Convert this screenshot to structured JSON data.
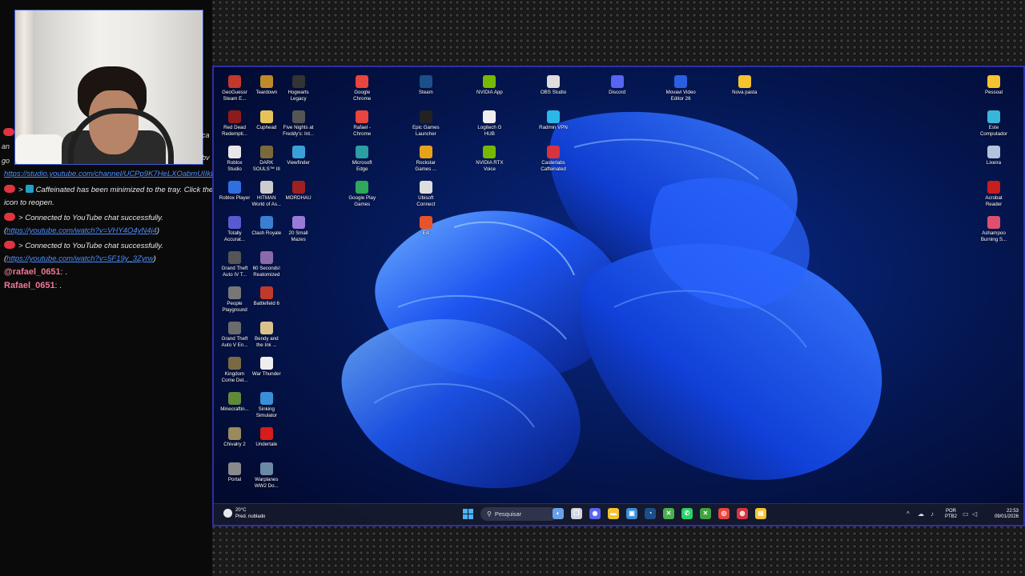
{
  "chat": {
    "side_fragments": {
      "left_a": "an",
      "left_b": "go",
      "right_a": "ca",
      "right_b": "bv"
    },
    "studio_link": "https://studio.youtube.com/channel/UCPp9K7HeLXOabmUIIkEgZ",
    "lines": [
      {
        "id": "minimized",
        "prefix": ">",
        "app": "Caffeinated",
        "text": " has been minimized to the tray. Click the",
        "cont": "icon to reopen."
      },
      {
        "id": "connected1",
        "prefix": ">",
        "text": "Connected to YouTube chat successfully.",
        "link": "https://youtube.com/watch?v=VHY4O4yN4j4"
      },
      {
        "id": "connected2",
        "prefix": ">",
        "text": "Connected to YouTube chat successfully.",
        "link": "https://youtube.com/watch?v=5F19y_3Zyrw"
      }
    ],
    "messages": [
      {
        "user": "@rafael_0651",
        "text": ": ."
      },
      {
        "user": "Rafael_0651",
        "text": ": ."
      }
    ]
  },
  "desktop": {
    "icons": [
      {
        "col": 0,
        "row": 0,
        "label": "GeoGuessr\nSteam E...",
        "icon": "geoguessr-icon",
        "color": "#c0392b"
      },
      {
        "col": 0,
        "row": 1,
        "label": "Red Dead\nRedempti...",
        "icon": "red-dead-icon",
        "color": "#8e1b1b"
      },
      {
        "col": 0,
        "row": 2,
        "label": "Roblox\nStudio",
        "icon": "roblox-studio-icon",
        "color": "#e8e8e8"
      },
      {
        "col": 0,
        "row": 3,
        "label": "Roblox Player",
        "icon": "roblox-player-icon",
        "color": "#2f6fe0"
      },
      {
        "col": 0,
        "row": 4,
        "label": "Totally\nAccurat...",
        "icon": "tabs-icon",
        "color": "#5a5acf"
      },
      {
        "col": 0,
        "row": 5,
        "label": "Grand Theft\nAuto IV T...",
        "icon": "gta4-icon",
        "color": "#555"
      },
      {
        "col": 0,
        "row": 6,
        "label": "People\nPlayground",
        "icon": "people-playground-icon",
        "color": "#777"
      },
      {
        "col": 0,
        "row": 7,
        "label": "Grand Theft\nAuto V En...",
        "icon": "gta5-icon",
        "color": "#6b6b6b"
      },
      {
        "col": 0,
        "row": 8,
        "label": "Kingdom\nCome Del...",
        "icon": "kingdom-come-icon",
        "color": "#7a6a44"
      },
      {
        "col": 0,
        "row": 9,
        "label": "Minecraftin...",
        "icon": "minecraft-icon",
        "color": "#5f8a3a"
      },
      {
        "col": 0,
        "row": 10,
        "label": "Chivalry 2",
        "icon": "chivalry-icon",
        "color": "#9b8a5c"
      },
      {
        "col": 0,
        "row": 11,
        "label": "Portal",
        "icon": "portal-icon",
        "color": "#8a8a8a"
      },
      {
        "col": 1,
        "row": 0,
        "label": "Teardown",
        "icon": "teardown-icon",
        "color": "#c08a2a"
      },
      {
        "col": 1,
        "row": 1,
        "label": "Cuphead",
        "icon": "cuphead-icon",
        "color": "#e6c35a"
      },
      {
        "col": 1,
        "row": 2,
        "label": "DARK\nSOULS™ III",
        "icon": "dark-souls-icon",
        "color": "#7a6a3a"
      },
      {
        "col": 1,
        "row": 3,
        "label": "HITMAN\nWorld of As...",
        "icon": "hitman-icon",
        "color": "#cccccc"
      },
      {
        "col": 1,
        "row": 4,
        "label": "Clash Royale",
        "icon": "clash-royale-icon",
        "color": "#3a7fd0"
      },
      {
        "col": 1,
        "row": 5,
        "label": "60 Seconds!\nReatomized",
        "icon": "sixty-seconds-icon",
        "color": "#8a6aa8"
      },
      {
        "col": 1,
        "row": 6,
        "label": "Battlefield 6",
        "icon": "battlefield-icon",
        "color": "#c0392b"
      },
      {
        "col": 1,
        "row": 7,
        "label": "Bendy and\nthe Ink ...",
        "icon": "bendy-icon",
        "color": "#d9c38a"
      },
      {
        "col": 1,
        "row": 8,
        "label": "War Thunder",
        "icon": "war-thunder-icon",
        "color": "#eeeeee"
      },
      {
        "col": 1,
        "row": 9,
        "label": "Sinking\nSimulator",
        "icon": "sinking-simulator-icon",
        "color": "#3a8fd8"
      },
      {
        "col": 1,
        "row": 10,
        "label": "Undertale",
        "icon": "undertale-icon",
        "color": "#d81b1b"
      },
      {
        "col": 1,
        "row": 11,
        "label": "Warplanes\nWW2 Do...",
        "icon": "warplanes-icon",
        "color": "#6a8aa8"
      },
      {
        "col": 2,
        "row": 0,
        "label": "Hogwarts\nLegacy",
        "icon": "hogwarts-icon",
        "color": "#333"
      },
      {
        "col": 2,
        "row": 1,
        "label": "Five Nights at\nFreddy's: Int...",
        "icon": "fnaf-icon",
        "color": "#555"
      },
      {
        "col": 2,
        "row": 2,
        "label": "Viewfinder",
        "icon": "viewfinder-icon",
        "color": "#3aa0d8"
      },
      {
        "col": 2,
        "row": 3,
        "label": "MORDHAU",
        "icon": "mordhau-icon",
        "color": "#a02020"
      },
      {
        "col": 2,
        "row": 4,
        "label": "20 Small\nMazes",
        "icon": "mazes-icon",
        "color": "#9a7ad8"
      },
      {
        "col": 4,
        "row": 0,
        "label": "Google\nChrome",
        "icon": "chrome-icon",
        "color": "#e8453c"
      },
      {
        "col": 4,
        "row": 1,
        "label": "Rafael -\nChrome",
        "icon": "chrome-profile-icon",
        "color": "#e8453c"
      },
      {
        "col": 4,
        "row": 2,
        "label": "Microsoft\nEdge",
        "icon": "edge-icon",
        "color": "#2aa0a0"
      },
      {
        "col": 4,
        "row": 3,
        "label": "Google Play\nGames",
        "icon": "play-games-icon",
        "color": "#2fa85a"
      },
      {
        "col": 6,
        "row": 0,
        "label": "Steam",
        "icon": "steam-icon",
        "color": "#1b4f8a"
      },
      {
        "col": 6,
        "row": 1,
        "label": "Epic Games\nLauncher",
        "icon": "epic-icon",
        "color": "#222"
      },
      {
        "col": 6,
        "row": 2,
        "label": "Rockstar\nGames ...",
        "icon": "rockstar-icon",
        "color": "#e8a21a"
      },
      {
        "col": 6,
        "row": 3,
        "label": "Ubisoft\nConnect",
        "icon": "ubisoft-icon",
        "color": "#dddddd"
      },
      {
        "col": 6,
        "row": 4,
        "label": "EA",
        "icon": "ea-icon",
        "color": "#e8542a"
      },
      {
        "col": 8,
        "row": 0,
        "label": "NVIDIA App",
        "icon": "nvidia-icon",
        "color": "#76b900"
      },
      {
        "col": 8,
        "row": 1,
        "label": "Logitech G\nHUB",
        "icon": "logitech-icon",
        "color": "#eeeeee"
      },
      {
        "col": 8,
        "row": 2,
        "label": "NVIDIA RTX\nVoice",
        "icon": "rtx-voice-icon",
        "color": "#76b900"
      },
      {
        "col": 10,
        "row": 0,
        "label": "OBS Studio",
        "icon": "obs-icon",
        "color": "#dddddd"
      },
      {
        "col": 10,
        "row": 1,
        "label": "Radmin VPN",
        "icon": "radmin-icon",
        "color": "#2ab8e8"
      },
      {
        "col": 10,
        "row": 2,
        "label": "Casterlabs\nCaffeinated",
        "icon": "caffeinated-icon",
        "color": "#d8343f"
      },
      {
        "col": 12,
        "row": 0,
        "label": "Discord",
        "icon": "discord-icon",
        "color": "#5865f2"
      },
      {
        "col": 14,
        "row": 0,
        "label": "Movavi Video\nEditor 26",
        "icon": "movavi-icon",
        "color": "#2a60e0"
      },
      {
        "col": 16,
        "row": 0,
        "label": "Nova pasta",
        "icon": "folder-icon",
        "color": "#f4c430"
      }
    ],
    "right_icons": [
      {
        "row": 0,
        "label": "Pessoal",
        "icon": "folder-icon",
        "color": "#f4c430"
      },
      {
        "row": 1,
        "label": "Este\nComputador",
        "icon": "computer-icon",
        "color": "#39b7d8"
      },
      {
        "row": 2,
        "label": "Lixeira",
        "icon": "recycle-bin-icon",
        "color": "#b0c4de"
      },
      {
        "row": 3,
        "label": "Acrobat\nReader",
        "icon": "acrobat-icon",
        "color": "#c81e1e"
      },
      {
        "row": 4,
        "label": "Ashampoo\nBurning S...",
        "icon": "ashampoo-icon",
        "color": "#e0506e"
      }
    ]
  },
  "taskbar": {
    "weather": {
      "temp": "20°C",
      "desc": "Pred. nublado",
      "icon": "cloud-icon"
    },
    "search_placeholder": "Pesquisar",
    "apps": [
      {
        "name": "copilot-icon",
        "color": "#6aa0e8",
        "glyph": "◐"
      },
      {
        "name": "task-view-icon",
        "color": "#cfd4e0",
        "glyph": "❐"
      },
      {
        "name": "discord-icon",
        "color": "#5865f2",
        "glyph": "◉"
      },
      {
        "name": "file-explorer-icon",
        "color": "#f4c430",
        "glyph": "▬"
      },
      {
        "name": "store-icon",
        "color": "#3a8fd8",
        "glyph": "▣"
      },
      {
        "name": "steam-icon",
        "color": "#1b4f8a",
        "glyph": "◔"
      },
      {
        "name": "xbox-game-bar-icon",
        "color": "#4caf50",
        "glyph": "✕"
      },
      {
        "name": "whatsapp-icon",
        "color": "#25d366",
        "glyph": "✆"
      },
      {
        "name": "xbox-icon",
        "color": "#3fa33f",
        "glyph": "✕"
      },
      {
        "name": "chrome-icon",
        "color": "#e8453c",
        "glyph": "◎"
      },
      {
        "name": "caffeinated-icon",
        "color": "#d8343f",
        "glyph": "◍"
      },
      {
        "name": "chat-app-icon",
        "color": "#f4c430",
        "glyph": "▤"
      }
    ],
    "tray": {
      "lang1": "POR",
      "lang2": "PTB2",
      "time": "22:53",
      "date": "09/01/2026"
    }
  }
}
